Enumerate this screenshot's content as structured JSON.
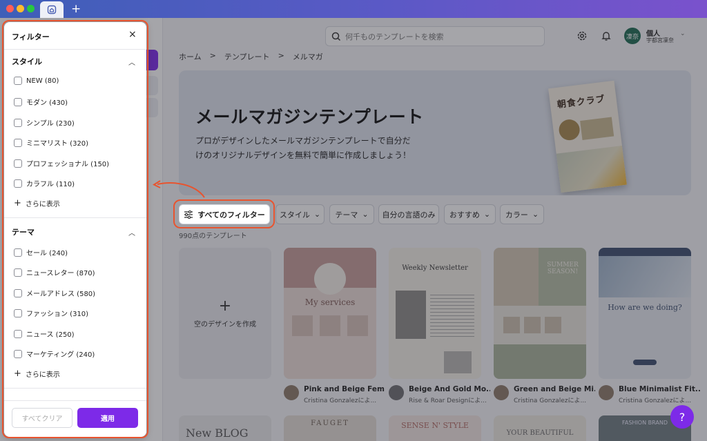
{
  "window": {
    "new_tab_symbol": "+"
  },
  "header": {
    "search_placeholder": "何千ものテンプレートを検索",
    "avatar_initials": "凜奈",
    "account_name": "個人",
    "account_sub": "宇都宮凜奈"
  },
  "breadcrumb": [
    "ホーム",
    "テンプレート",
    "メルマガ"
  ],
  "breadcrumb_sep": ">",
  "hero": {
    "title": "メールマガジンテンプレート",
    "description": "プロがデザインしたメールマガジンテンプレートで自分だけのオリジナルデザインを無料で簡単に作成しましょう！",
    "card_title": "朝食クラブ"
  },
  "chips": {
    "all_filters": "すべてのフィルター",
    "style": "スタイル",
    "theme": "テーマ",
    "my_language": "自分の言語のみ",
    "recommended": "おすすめ",
    "color": "カラー"
  },
  "result_count": "990点のテンプレート",
  "new_design": {
    "plus": "+",
    "label": "空のデザインを作成"
  },
  "templates": [
    {
      "title": "Pink and Beige Fem...",
      "author": "Cristina Gonzalezによ..."
    },
    {
      "title": "Beige And Gold Mo...",
      "author": "Rise & Roar Designによ..."
    },
    {
      "title": "Green and Beige Mi...",
      "author": "Cristina Gonzalezによ..."
    },
    {
      "title": "Blue Minimalist Fit...",
      "author": "Cristina Gonzalezによ..."
    }
  ],
  "template_art": {
    "t1_heading": "My services",
    "t2_heading": "Weekly Newsletter",
    "t3_heading": "SUMMER SEASON!",
    "t4_heading": "How are we doing?",
    "r2_1": "New BLOG",
    "r2_2": "FAUGET",
    "r2_3": "SENSE N' STYLE",
    "r2_4": "YOUR BEAUTIFUL",
    "r2_5": "FASHION BRAND"
  },
  "help_label": "?",
  "filter_panel": {
    "title": "フィルター",
    "close": "×",
    "sections": [
      {
        "title": "スタイル",
        "options": [
          "NEW (80)",
          "モダン (430)",
          "シンプル (230)",
          "ミニマリスト (320)",
          "プロフェッショナル (150)",
          "カラフル (110)"
        ],
        "more": "さらに表示"
      },
      {
        "title": "テーマ",
        "options": [
          "セール (240)",
          "ニュースレター (870)",
          "メールアドレス (580)",
          "ファッション (310)",
          "ニュース (250)",
          "マーケティング (240)"
        ],
        "more": "さらに表示"
      }
    ],
    "clear_all": "すべてクリア",
    "apply": "適用"
  },
  "colors": {
    "accent": "#7d2ae8",
    "highlight": "#e8542f"
  }
}
